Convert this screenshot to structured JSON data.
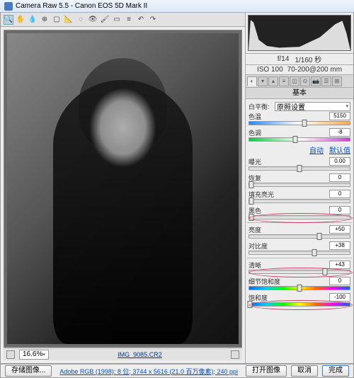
{
  "titlebar": {
    "app": "Camera Raw 5.5",
    "sep": " - ",
    "device": "Canon EOS 5D Mark II"
  },
  "meta": {
    "aperture": "f/14",
    "shutter": "1/160 秒",
    "iso": "ISO 100",
    "lens": "70-200@200 mm"
  },
  "panel_title": "基本",
  "wb": {
    "label": "白平衡:",
    "value": "原照设置"
  },
  "links": {
    "auto": "自动",
    "default": "默认值"
  },
  "sliders": {
    "temp": {
      "label": "色温",
      "value": "5150",
      "pos": 55,
      "track": "wb"
    },
    "tint": {
      "label": "色调",
      "value": "-8",
      "pos": 46,
      "track": "tint"
    },
    "exposure": {
      "label": "曝光",
      "value": "0.00",
      "pos": 50,
      "track": "plain"
    },
    "recovery": {
      "label": "恢复",
      "value": "0",
      "pos": 2,
      "track": "plain"
    },
    "fill": {
      "label": "填充亮光",
      "value": "0",
      "pos": 2,
      "track": "plain"
    },
    "black": {
      "label": "黑色",
      "value": "0",
      "pos": 2,
      "track": "plain",
      "circled": true
    },
    "bright": {
      "label": "亮度",
      "value": "+50",
      "pos": 70,
      "track": "plain"
    },
    "contrast": {
      "label": "对比度",
      "value": "+38",
      "pos": 65,
      "track": "plain"
    },
    "clarity": {
      "label": "清晰",
      "value": "+43",
      "pos": 75,
      "track": "plain",
      "circled": true
    },
    "vibrance": {
      "label": "细节饱和度",
      "value": "0",
      "pos": 50,
      "track": "color"
    },
    "saturation": {
      "label": "饱和度",
      "value": "-100",
      "pos": 1,
      "track": "color",
      "circled": true
    }
  },
  "zoom": "16.6%",
  "filename": "IMG_9085.CR2",
  "footer": {
    "save": "存储图像...",
    "info": "Adobe RGB (1998): 8 位; 3744 x 5616 (21.0 百万像素); 240 ppi",
    "open": "打开图像",
    "cancel": "取消",
    "done": "完成"
  }
}
